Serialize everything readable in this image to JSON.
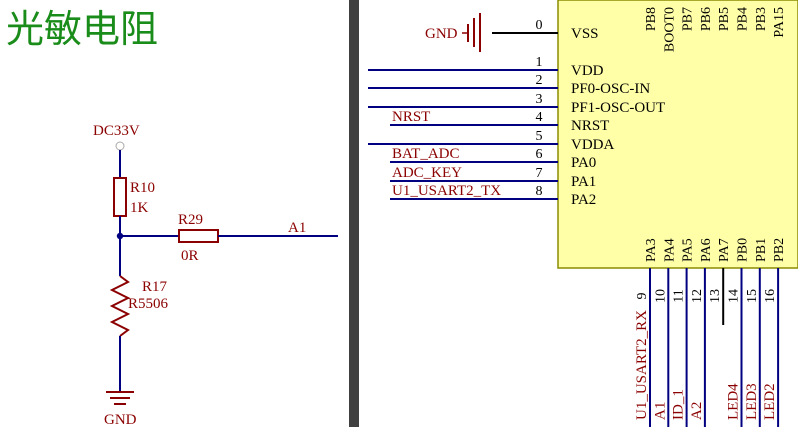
{
  "title": "光敏电阻",
  "colors": {
    "title": "#1a8c1a",
    "component": "#8b0000",
    "wire": "#000080",
    "pin": "#000000",
    "divider": "#404040",
    "chip_fill": "#ffffa8",
    "chip_stroke": "#8b8b00",
    "junction": "#000080"
  },
  "left_circuit": {
    "power_net": "DC33V",
    "r10": {
      "ref": "R10",
      "value": "1K"
    },
    "r29": {
      "ref": "R29",
      "value": "0R"
    },
    "r17": {
      "ref": "R17",
      "value": "R5506"
    },
    "net_out": "A1",
    "ground": "GND"
  },
  "mcu": {
    "gnd_net": "GND",
    "left_pins": [
      {
        "num": "0",
        "name": "VSS",
        "net": ""
      },
      {
        "num": "1",
        "name": "VDD",
        "net": ""
      },
      {
        "num": "2",
        "name": "PF0-OSC-IN",
        "net": ""
      },
      {
        "num": "3",
        "name": "PF1-OSC-OUT",
        "net": ""
      },
      {
        "num": "4",
        "name": "NRST",
        "net": "NRST"
      },
      {
        "num": "5",
        "name": "VDDA",
        "net": ""
      },
      {
        "num": "6",
        "name": "PA0",
        "net": "BAT_ADC"
      },
      {
        "num": "7",
        "name": "PA1",
        "net": "ADC_KEY"
      },
      {
        "num": "8",
        "name": "PA2",
        "net": "U1_USART2_TX"
      }
    ],
    "top_pins": [
      "PB8",
      "BOOT0",
      "PB7",
      "PB6",
      "PB5",
      "PB4",
      "PB3",
      "PA15"
    ],
    "bottom_pins": [
      {
        "num": "9",
        "name": "PA3",
        "net": "U1_USART2_RX"
      },
      {
        "num": "10",
        "name": "PA4",
        "net": "A1"
      },
      {
        "num": "11",
        "name": "PA5",
        "net": "ID_1"
      },
      {
        "num": "12",
        "name": "PA6",
        "net": "A2"
      },
      {
        "num": "13",
        "name": "PA7",
        "net": ""
      },
      {
        "num": "14",
        "name": "PB0",
        "net": "LED4"
      },
      {
        "num": "15",
        "name": "PB1",
        "net": "LED3"
      },
      {
        "num": "16",
        "name": "PB2",
        "net": "LED2"
      }
    ]
  }
}
